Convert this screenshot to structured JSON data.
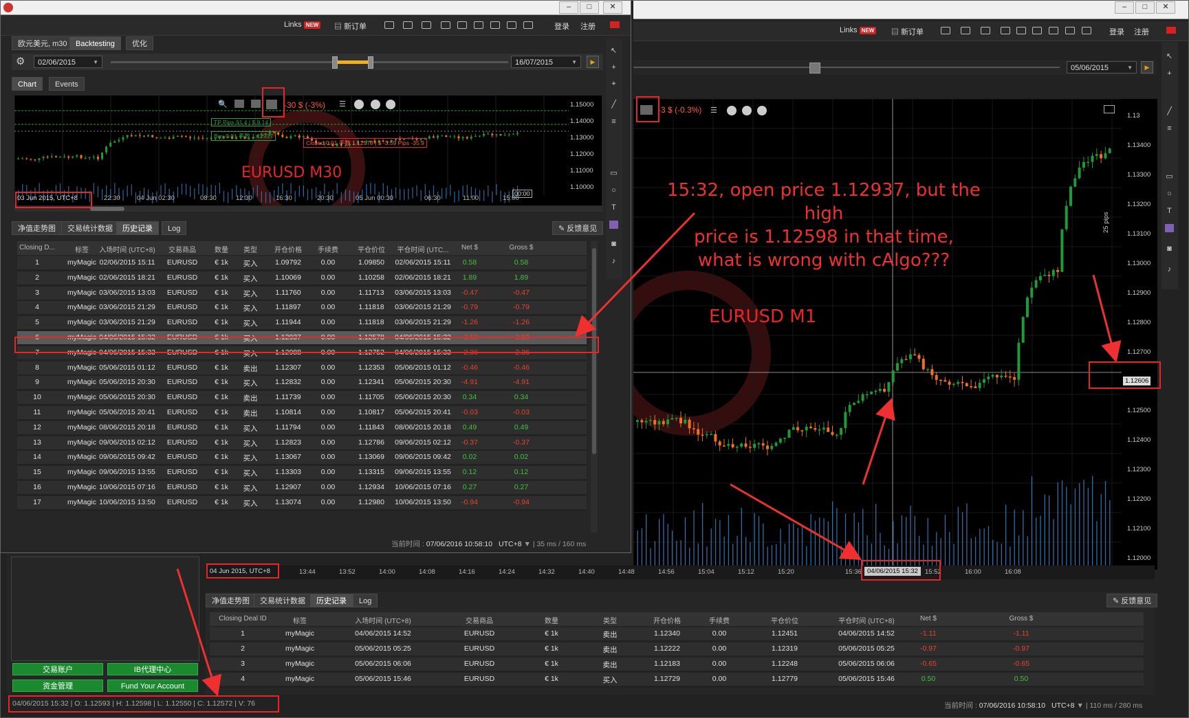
{
  "topbar": {
    "links_label": "Links",
    "new_badge": "NEW",
    "new_order": "新订单",
    "login": "登录",
    "register": "注册"
  },
  "window_small": {
    "symbol_tab": "欧元美元, m30",
    "backtesting_tab": "Backtesting",
    "optimize_tab": "优化",
    "start_date": "02/06/2015",
    "end_date": "16/07/2015",
    "chart_tab": "Chart",
    "events_tab": "Events",
    "pnl_overlay": "-30 $ (-3%)",
    "tp_label": "TP  Pips 91.4  |  $ 9.14",
    "buy_label": "Buy  0.01 手数  1.12937",
    "closed_label": "Closed  0.01 手数  1.12578  |  $ -3.59  Pips -35.9",
    "watermark": "EURUSD  M30",
    "timezone_tag": "03 Jun 2015, UTC+8",
    "cursor_tag": "00:00",
    "yticks": [
      "1.15000",
      "1.14000",
      "1.13000",
      "1.12000",
      "1.11000",
      "1.10000"
    ],
    "xticks": [
      "22:30",
      "04 Jun 02:30",
      "08:30",
      "12:30",
      "16:30",
      "20:30",
      "05 Jun 00:30",
      "06:30",
      "11:00",
      "15:00"
    ],
    "bottom_tabs": [
      "净值走势图",
      "交易统计数据",
      "历史记录",
      "Log"
    ],
    "feedback": "反馈意见",
    "headers": [
      "Closing D...",
      "标签",
      "入场时间 (UTC+8)",
      "交易商品",
      "数量",
      "类型",
      "开仓价格",
      "手续费",
      "平仓价位",
      "平仓时间 (UTC...",
      "Net $",
      "Gross $"
    ],
    "rows": [
      [
        "1",
        "myMagic",
        "02/06/2015 15:11",
        "EURUSD",
        "€ 1k",
        "买入",
        "1.09792",
        "0.00",
        "1.09850",
        "02/06/2015 15:11",
        "0.58",
        "0.58"
      ],
      [
        "2",
        "myMagic",
        "02/06/2015 18:21",
        "EURUSD",
        "€ 1k",
        "买入",
        "1.10069",
        "0.00",
        "1.10258",
        "02/06/2015 18:21",
        "1.89",
        "1.89"
      ],
      [
        "3",
        "myMagic",
        "03/06/2015 13:03",
        "EURUSD",
        "€ 1k",
        "买入",
        "1.11760",
        "0.00",
        "1.11713",
        "03/06/2015 13:03",
        "-0.47",
        "-0.47"
      ],
      [
        "4",
        "myMagic",
        "03/06/2015 21:29",
        "EURUSD",
        "€ 1k",
        "买入",
        "1.11897",
        "0.00",
        "1.11818",
        "03/06/2015 21:29",
        "-0.79",
        "-0.79"
      ],
      [
        "5",
        "myMagic",
        "03/06/2015 21:29",
        "EURUSD",
        "€ 1k",
        "买入",
        "1.11944",
        "0.00",
        "1.11818",
        "03/06/2015 21:29",
        "-1.26",
        "-1.26"
      ],
      [
        "6",
        "myMagic",
        "04/06/2015 15:32",
        "EURUSD",
        "€ 1k",
        "买入",
        "1.12937",
        "0.00",
        "1.12578",
        "04/06/2015 15:32",
        "-3.59",
        "-3.59"
      ],
      [
        "7",
        "myMagic",
        "04/06/2015 15:33",
        "EURUSD",
        "€ 1k",
        "买入",
        "1.12988",
        "0.00",
        "1.12752",
        "04/06/2015 15:33",
        "-2.36",
        "-2.36"
      ],
      [
        "8",
        "myMagic",
        "05/06/2015 01:12",
        "EURUSD",
        "€ 1k",
        "卖出",
        "1.12307",
        "0.00",
        "1.12353",
        "05/06/2015 01:12",
        "-0.46",
        "-0.46"
      ],
      [
        "9",
        "myMagic",
        "05/06/2015 20:30",
        "EURUSD",
        "€ 1k",
        "买入",
        "1.12832",
        "0.00",
        "1.12341",
        "05/06/2015 20:30",
        "-4.91",
        "-4.91"
      ],
      [
        "10",
        "myMagic",
        "05/06/2015 20:30",
        "EURUSD",
        "€ 1k",
        "卖出",
        "1.11739",
        "0.00",
        "1.11705",
        "05/06/2015 20:30",
        "0.34",
        "0.34"
      ],
      [
        "11",
        "myMagic",
        "05/06/2015 20:41",
        "EURUSD",
        "€ 1k",
        "卖出",
        "1.10814",
        "0.00",
        "1.10817",
        "05/06/2015 20:41",
        "-0.03",
        "-0.03"
      ],
      [
        "12",
        "myMagic",
        "08/06/2015 20:18",
        "EURUSD",
        "€ 1k",
        "买入",
        "1.11794",
        "0.00",
        "1.11843",
        "08/06/2015 20:18",
        "0.49",
        "0.49"
      ],
      [
        "13",
        "myMagic",
        "09/06/2015 02:12",
        "EURUSD",
        "€ 1k",
        "买入",
        "1.12823",
        "0.00",
        "1.12786",
        "09/06/2015 02:12",
        "-0.37",
        "-0.37"
      ],
      [
        "14",
        "myMagic",
        "09/06/2015 09:42",
        "EURUSD",
        "€ 1k",
        "买入",
        "1.13067",
        "0.00",
        "1.13069",
        "09/06/2015 09:42",
        "0.02",
        "0.02"
      ],
      [
        "15",
        "myMagic",
        "09/06/2015 13:55",
        "EURUSD",
        "€ 1k",
        "买入",
        "1.13303",
        "0.00",
        "1.13315",
        "09/06/2015 13:55",
        "0.12",
        "0.12"
      ],
      [
        "16",
        "myMagic",
        "10/06/2015 07:16",
        "EURUSD",
        "€ 1k",
        "买入",
        "1.12907",
        "0.00",
        "1.12934",
        "10/06/2015 07:16",
        "0.27",
        "0.27"
      ],
      [
        "17",
        "myMagic",
        "10/06/2015 13:50",
        "EURUSD",
        "€ 1k",
        "买入",
        "1.13074",
        "0.00",
        "1.12980",
        "10/06/2015 13:50",
        "-0.94",
        "-0.94"
      ]
    ],
    "status_label": "当前时间 :",
    "status_time": "07/06/2016 10:58:10",
    "status_tz": "UTC+8",
    "status_perf": "35 ms / 160 ms"
  },
  "window_big": {
    "date": "05/06/2015",
    "pnl_overlay": "-3 $ (-0.3%)",
    "pips_label": "25 pips",
    "watermark": "EURUSD  M1",
    "price_tag": "1.12606",
    "yticks": [
      "1.13",
      "1.13400",
      "1.13300",
      "1.13200",
      "1.13100",
      "1.13000",
      "1.12900",
      "1.12800",
      "1.12700",
      "1.12606",
      "1.12500",
      "1.12400",
      "1.12300",
      "1.12200",
      "1.12100",
      "1.12000"
    ],
    "timezone_tag": "04 Jun 2015, UTC+8",
    "xticks": [
      "13:44",
      "13:52",
      "14:00",
      "14:08",
      "14:16",
      "14:24",
      "14:32",
      "14:40",
      "14:48",
      "14:56",
      "15:04",
      "15:12",
      "15:20",
      "15:36",
      "15:44",
      "15:52",
      "16:00",
      "16:08"
    ],
    "cursor_date": "04/06/2015 15:32",
    "cursor_tag": "00:00",
    "bottom_tabs": [
      "净值走势图",
      "交易统计数据",
      "历史记录",
      "Log"
    ],
    "feedback": "反馈意见",
    "headers": [
      "Closing Deal ID",
      "标签",
      "入场时间 (UTC+8)",
      "交易商品",
      "数量",
      "类型",
      "开仓价格",
      "手续费",
      "平仓价位",
      "平仓时间 (UTC+8)",
      "Net $",
      "Gross $"
    ],
    "rows": [
      [
        "1",
        "myMagic",
        "04/06/2015 14:52",
        "EURUSD",
        "€ 1k",
        "卖出",
        "1.12340",
        "0.00",
        "1.12451",
        "04/06/2015 14:52",
        "-1.11",
        "-1.11"
      ],
      [
        "2",
        "myMagic",
        "05/06/2015 05:25",
        "EURUSD",
        "€ 1k",
        "卖出",
        "1.12222",
        "0.00",
        "1.12319",
        "05/06/2015 05:25",
        "-0.97",
        "-0.97"
      ],
      [
        "3",
        "myMagic",
        "05/06/2015 06:06",
        "EURUSD",
        "€ 1k",
        "卖出",
        "1.12183",
        "0.00",
        "1.12248",
        "05/06/2015 06:06",
        "-0.65",
        "-0.65"
      ],
      [
        "4",
        "myMagic",
        "05/06/2015 15:46",
        "EURUSD",
        "€ 1k",
        "买入",
        "1.12729",
        "0.00",
        "1.12779",
        "05/06/2015 15:46",
        "0.50",
        "0.50"
      ]
    ],
    "status_label": "当前时间 :",
    "status_time": "07/06/2016 10:58:10",
    "status_tz": "UTC+8",
    "status_perf": "110 ms / 280 ms"
  },
  "left_panel": {
    "btn_account": "交易账户",
    "btn_ib": "IB代理中心",
    "btn_funds": "资金管理",
    "btn_fund_account": "Fund Your Account",
    "ohlc_status": "04/06/2015 15:32 | O: 1.12593 | H: 1.12598 | L: 1.12550 | C: 1.12572 | V: 76"
  },
  "annotation": {
    "line1": "15:32, open price 1.12937, but the high",
    "line2": "price is 1.12598 in that time,",
    "line3": "what is wrong with cAlgo???"
  },
  "colors": {
    "up": "#1e9a3a",
    "down": "#f07020",
    "annotation": "#f03030",
    "volume": "#3a7fc0"
  }
}
